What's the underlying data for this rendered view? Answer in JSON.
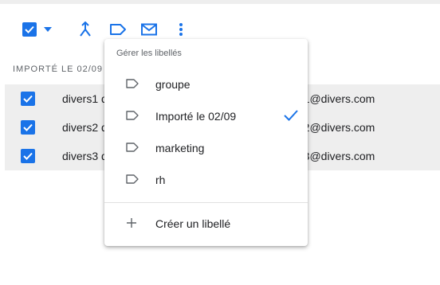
{
  "section_header": "IMPORTÉ LE 02/09",
  "rows": [
    {
      "name": "divers1 d",
      "email": "rs1@divers.com"
    },
    {
      "name": "divers2 d",
      "email": "rs2@divers.com"
    },
    {
      "name": "divers3 d",
      "email": "rs3@divers.com"
    }
  ],
  "menu": {
    "title": "Gérer les libellés",
    "items": [
      {
        "label": "groupe",
        "checked": false
      },
      {
        "label": "Importé le 02/09",
        "checked": true
      },
      {
        "label": "marketing",
        "checked": false
      },
      {
        "label": "rh",
        "checked": false
      }
    ],
    "create_label": "Créer un libellé"
  },
  "colors": {
    "accent": "#1a73e8",
    "row_bg": "#eeeeee",
    "icon_gray": "#5f6368"
  }
}
